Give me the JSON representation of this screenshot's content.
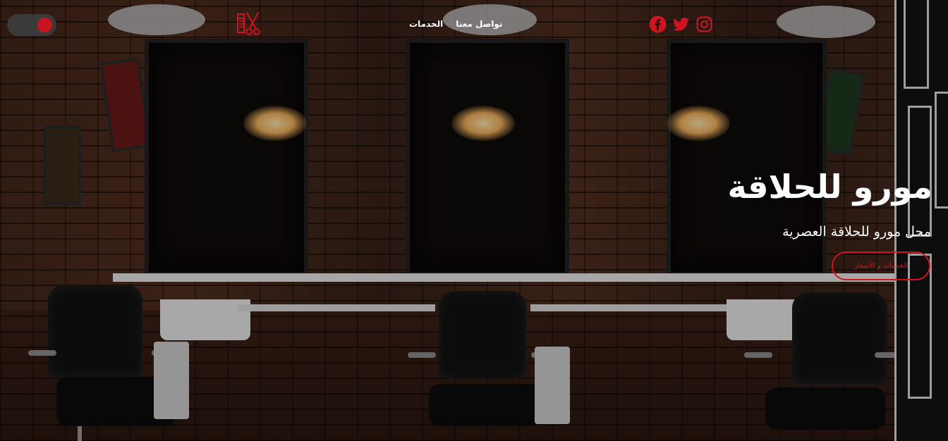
{
  "header": {
    "toggle_label": "",
    "nav": [
      {
        "label": "الخدمات"
      },
      {
        "label": "تواصل معنا"
      }
    ],
    "social_icons": [
      "facebook-icon",
      "twitter-icon",
      "instagram-icon"
    ]
  },
  "hero": {
    "title": "مورو للحلاقة",
    "subtitle": "محل مورو للحلاقة العصرية",
    "cta_label": "الخدمات و الأسعار"
  },
  "colors": {
    "accent": "#d0141f",
    "text": "#ffffff",
    "toggle_track": "#3a3a3a"
  }
}
